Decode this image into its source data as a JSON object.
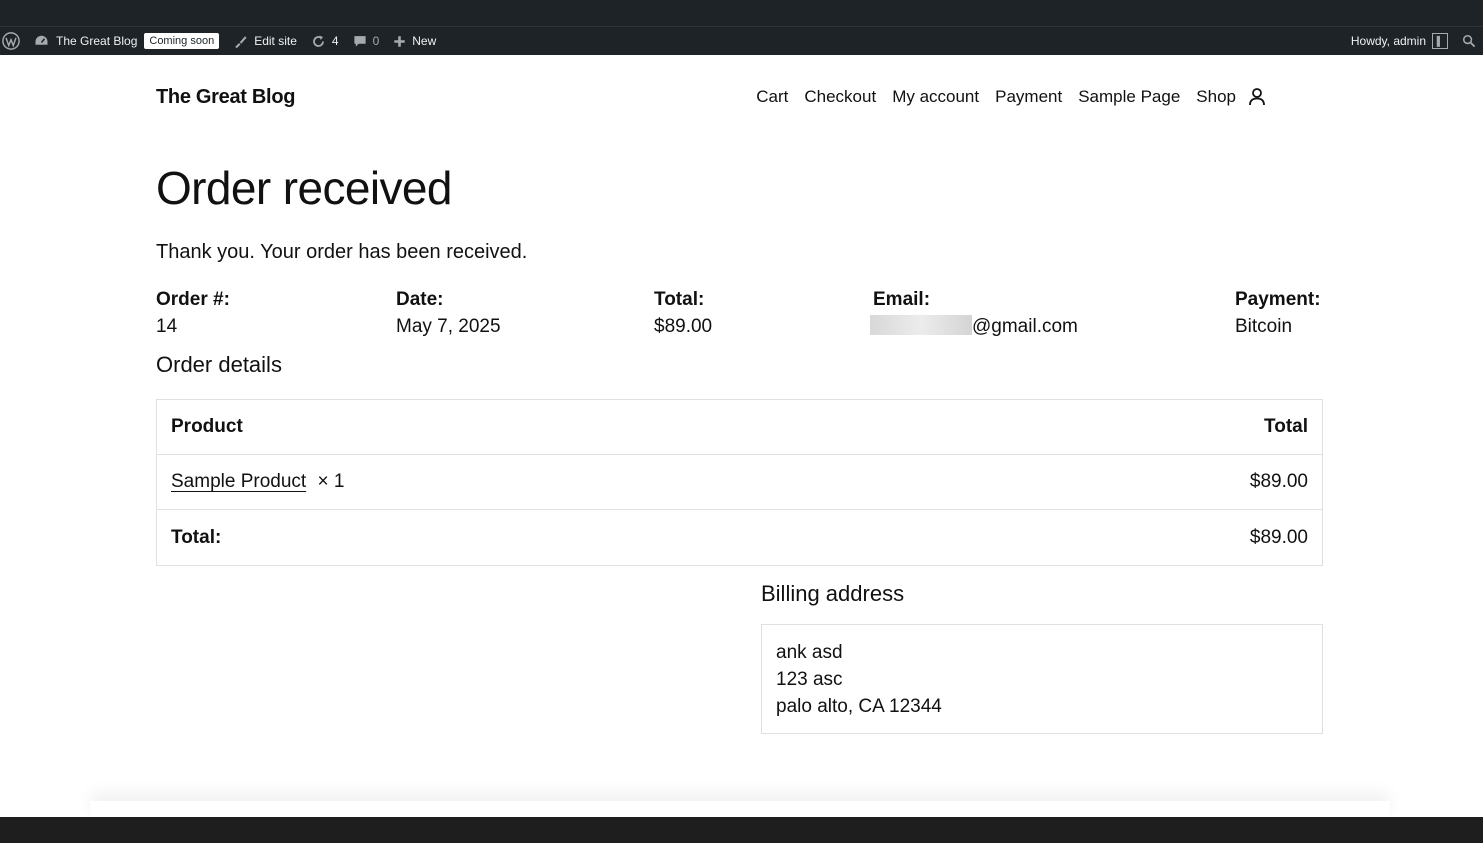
{
  "adminbar": {
    "site_name": "The Great Blog",
    "badge": "Coming soon",
    "edit_site": "Edit site",
    "updates_count": "4",
    "comments_count": "0",
    "new_label": "New",
    "howdy": "Howdy, admin"
  },
  "header": {
    "site_title": "The Great Blog",
    "nav": [
      "Cart",
      "Checkout",
      "My account",
      "Payment",
      "Sample Page",
      "Shop"
    ]
  },
  "order": {
    "title": "Order received",
    "thanks": "Thank you. Your order has been received.",
    "overview": {
      "order_label": "Order #:",
      "order_value": "14",
      "date_label": "Date:",
      "date_value": "May 7, 2025",
      "total_label": "Total:",
      "total_value": "$89.00",
      "email_label": "Email:",
      "email_value": "@gmail.com",
      "payment_label": "Payment:",
      "payment_value": "Bitcoin"
    },
    "details_title": "Order details",
    "table": {
      "col_product": "Product",
      "col_total": "Total",
      "item_name": "Sample Product",
      "item_qty": "× 1",
      "item_total": "$89.00",
      "footer_label": "Total:",
      "footer_total": "$89.00"
    },
    "billing": {
      "title": "Billing address",
      "lines": [
        "ank asd",
        "123 asc",
        "palo alto, CA 12344"
      ]
    }
  },
  "colors": {
    "adminbar_bg": "#1d2327",
    "page_bg": "#ffffff",
    "text": "#111111",
    "border": "#e0e0e0"
  }
}
